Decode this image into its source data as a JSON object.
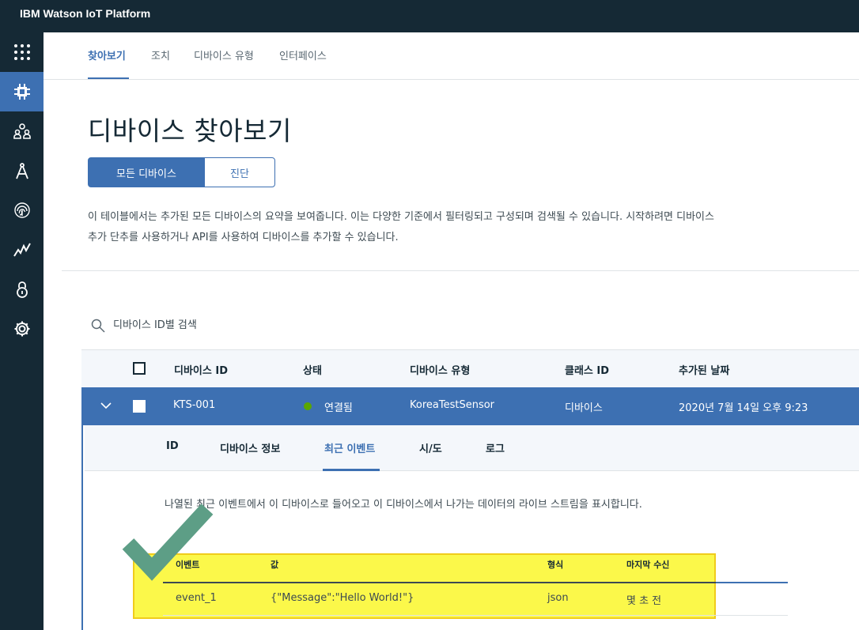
{
  "app": {
    "title": "IBM Watson IoT Platform"
  },
  "sidebar": {
    "items": [
      {
        "icon": "apps-grid-icon"
      },
      {
        "icon": "chip-icon",
        "active": true
      },
      {
        "icon": "members-icon"
      },
      {
        "icon": "compass-icon"
      },
      {
        "icon": "fingerprint-icon"
      },
      {
        "icon": "usage-chart-icon"
      },
      {
        "icon": "security-lock-icon"
      },
      {
        "icon": "settings-gear-icon"
      }
    ]
  },
  "tabs": [
    {
      "label": "찾아보기",
      "active": true
    },
    {
      "label": "조치"
    },
    {
      "label": "디바이스 유형"
    },
    {
      "label": "인터페이스"
    }
  ],
  "page": {
    "title": "디바이스 찾아보기",
    "segments": {
      "all": "모든 디바이스",
      "diagnose": "진단"
    },
    "description": "이 테이블에서는 추가된 모든 디바이스의 요약을 보여줍니다. 이는 다양한 기준에서 필터링되고 구성되며 검색될 수 있습니다. 시작하려면 디바이스 추가 단추를 사용하거나 API를 사용하여 디바이스를 추가할 수 있습니다."
  },
  "search": {
    "placeholder": "디바이스 ID별 검색"
  },
  "table": {
    "headers": {
      "device_id": "디바이스 ID",
      "status": "상태",
      "device_type": "디바이스 유형",
      "class_id": "클래스 ID",
      "date_added": "추가된 날짜"
    },
    "rows": [
      {
        "device_id": "KTS-001",
        "status": "연결됨",
        "device_type": "KoreaTestSensor",
        "class_id": "디바이스",
        "date_added": "2020년 7월 14일 오후 9:23"
      }
    ]
  },
  "detail": {
    "tabs": [
      {
        "label": "ID"
      },
      {
        "label": "디바이스 정보"
      },
      {
        "label": "최근 이벤트",
        "active": true
      },
      {
        "label": "시/도"
      },
      {
        "label": "로그"
      }
    ],
    "description": "나열된 최근 이벤트에서 이 디바이스로 들어오고 이 디바이스에서 나가는 데이터의 라이브 스트림을 표시합니다.",
    "events": {
      "headers": {
        "event": "이벤트",
        "value": "값",
        "format": "형식",
        "last_received": "마지막 수신"
      },
      "rows": [
        {
          "event": "event_1",
          "value": "{\"Message\":\"Hello World!\"}",
          "format": "json",
          "last_received": "몇 초 전"
        }
      ]
    }
  },
  "colors": {
    "nav": "#152935",
    "accent": "#3d70b2",
    "highlight": "#fbf84a",
    "checkmark": "#5d9e86",
    "connected": "#5aa700"
  }
}
